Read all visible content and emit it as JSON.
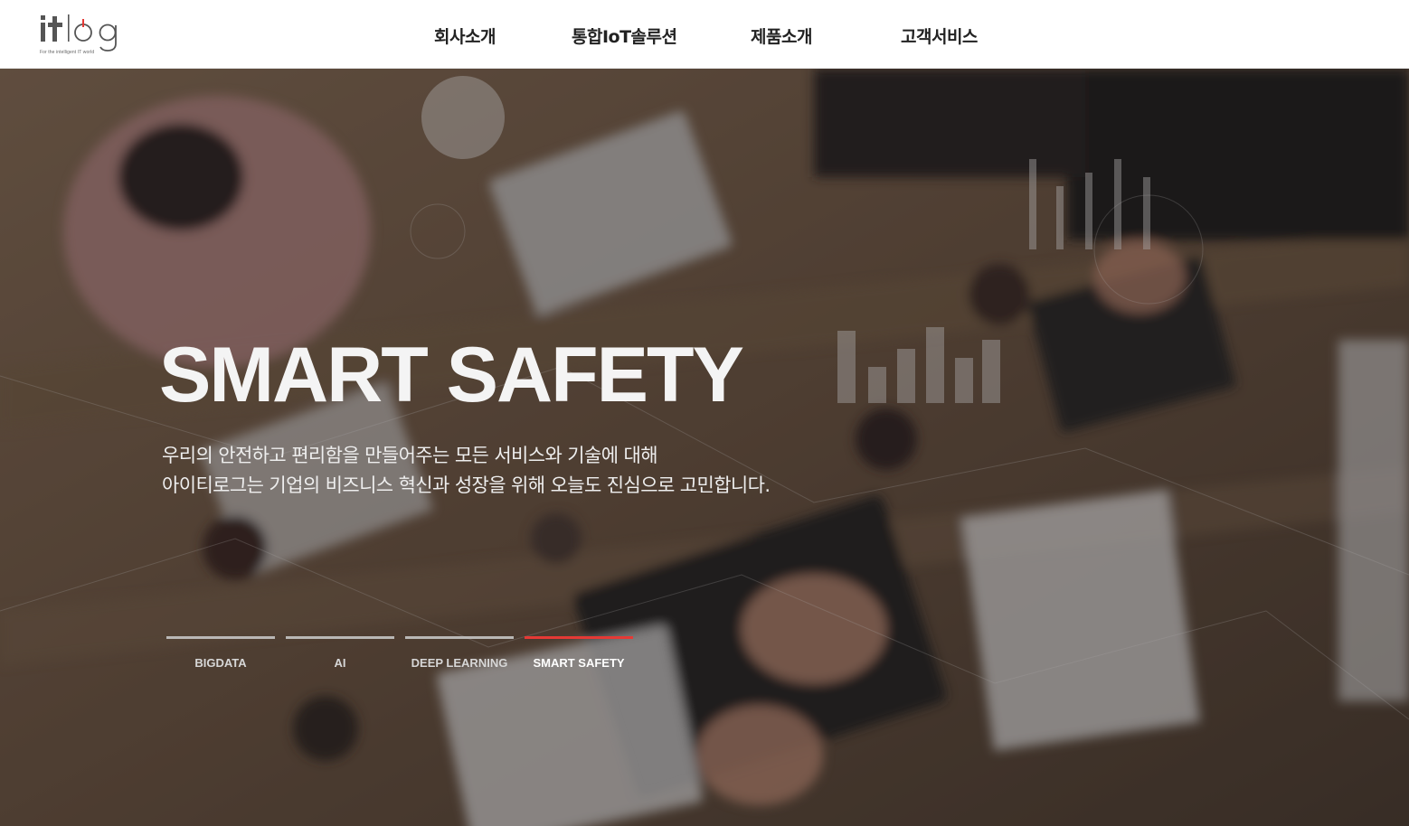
{
  "brand": {
    "logo_text": "itlog",
    "tagline": "For the intelligent IT world"
  },
  "nav": {
    "items": [
      {
        "label": "회사소개"
      },
      {
        "label": "통합IoT솔루션"
      },
      {
        "label": "제품소개"
      },
      {
        "label": "고객서비스"
      }
    ]
  },
  "hero": {
    "title": "SMART SAFETY",
    "description_lines": [
      "우리의 안전하고 편리함을 만들어주는 모든 서비스와 기술에 대해",
      "아이티로그는 기업의 비즈니스 혁신과 성장을 위해 오늘도 진심으로 고민합니다."
    ],
    "slides": [
      {
        "label": "BIGDATA",
        "active": false
      },
      {
        "label": "AI",
        "active": false
      },
      {
        "label": "DEEP LEARNING",
        "active": false
      },
      {
        "label": "SMART SAFETY",
        "active": true
      }
    ]
  },
  "colors": {
    "accent": "#e53935",
    "header_bg": "#ffffff",
    "nav_text": "#222222",
    "logo_gray": "#555555",
    "logo_power_red": "#e53935"
  }
}
